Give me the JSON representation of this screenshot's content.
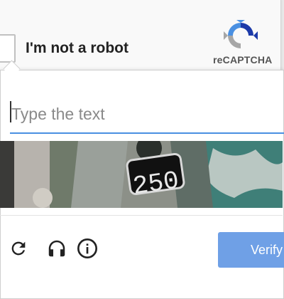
{
  "anchor": {
    "checkbox_label": "I'm not a robot",
    "brand": "reCAPTCHA",
    "logo_icon": "recaptcha-logo-icon",
    "checked": false
  },
  "challenge": {
    "input_placeholder": "Type the text",
    "input_value": "",
    "image_text": "250",
    "toolbar": {
      "reload_icon": "reload-icon",
      "audio_icon": "headphones-icon",
      "info_icon": "info-icon"
    },
    "verify_label": "Verify"
  },
  "colors": {
    "accent": "#4a90e2",
    "verify_bg": "#6fa0e6",
    "logo_blue": "#1c3aa9",
    "logo_light": "#4a90e2",
    "logo_gray": "#a6a6a6"
  }
}
